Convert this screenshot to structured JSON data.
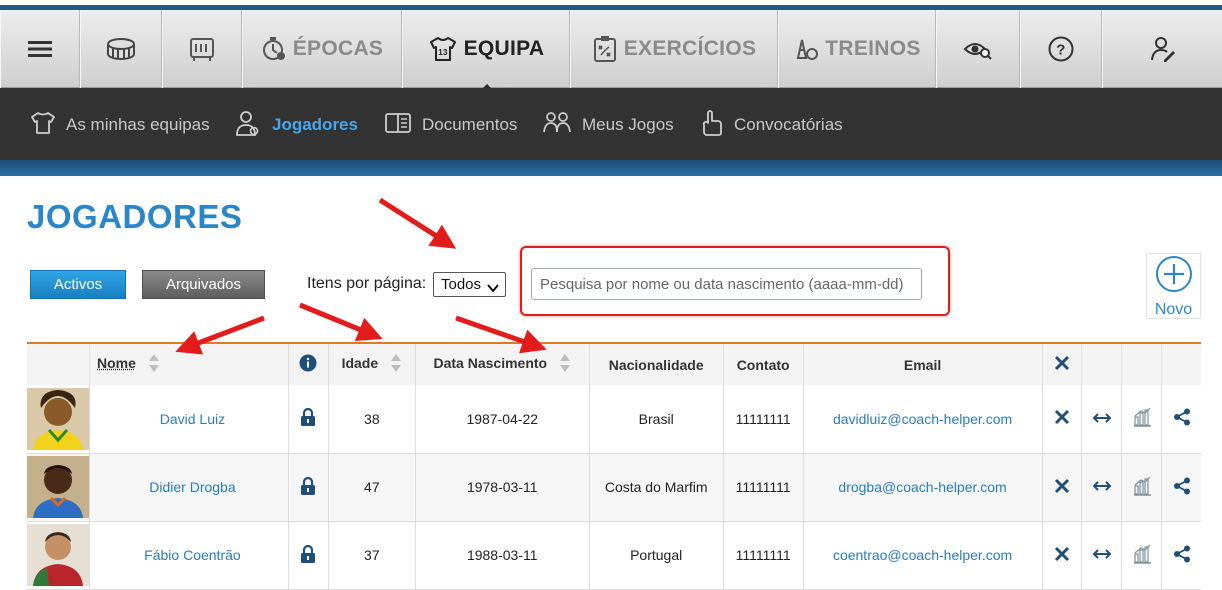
{
  "main_nav": {
    "items": [
      {
        "id": "menu",
        "icon": "hamburger-menu-icon",
        "label": ""
      },
      {
        "id": "stadium",
        "icon": "stadium-icon",
        "label": ""
      },
      {
        "id": "board",
        "icon": "scoreboard-icon",
        "label": ""
      },
      {
        "id": "epocas",
        "icon": "stopwatch-icon",
        "label": "ÉPOCAS"
      },
      {
        "id": "equipa",
        "icon": "jersey-icon",
        "label": "EQUIPA",
        "active": true
      },
      {
        "id": "exercicios",
        "icon": "tactics-board-icon",
        "label": "EXERCÍCIOS"
      },
      {
        "id": "treinos",
        "icon": "cones-ball-icon",
        "label": "TREINOS"
      },
      {
        "id": "scout",
        "icon": "eye-search-icon",
        "label": ""
      },
      {
        "id": "help",
        "icon": "help-circle-icon",
        "label": ""
      },
      {
        "id": "user",
        "icon": "user-edit-icon",
        "label": ""
      }
    ]
  },
  "sub_nav": {
    "items": [
      {
        "icon": "jersey-outline-icon",
        "label": "As minhas equipas"
      },
      {
        "icon": "player-icon",
        "label": "Jogadores",
        "active": true
      },
      {
        "icon": "book-icon",
        "label": "Documentos"
      },
      {
        "icon": "people-icon",
        "label": "Meus Jogos"
      },
      {
        "icon": "hand-point-icon",
        "label": "Convocatórias"
      }
    ]
  },
  "page": {
    "title": "JOGADORES",
    "filter_active": "Activos",
    "filter_archived": "Arquivados",
    "per_page_label": "Itens por página:",
    "per_page_value": "Todos",
    "search_placeholder": "Pesquisa por nome ou data nascimento (aaaa-mm-dd)",
    "new_label": "Novo"
  },
  "table": {
    "headers": {
      "nome": "Nome",
      "idade": "Idade",
      "data_nascimento": "Data Nascimento",
      "nacionalidade": "Nacionalidade",
      "contato": "Contato",
      "email": "Email"
    },
    "rows": [
      {
        "nome": "David Luiz",
        "idade": "38",
        "data_nascimento": "1987-04-22",
        "nacionalidade": "Brasil",
        "contato": "11111111",
        "email": "davidluiz@coach-helper.com"
      },
      {
        "nome": "Didier Drogba",
        "idade": "47",
        "data_nascimento": "1978-03-11",
        "nacionalidade": "Costa do Marfim",
        "contato": "11111111",
        "email": "drogba@coach-helper.com"
      },
      {
        "nome": "Fábio Coentrão",
        "idade": "37",
        "data_nascimento": "1988-03-11",
        "nacionalidade": "Portugal",
        "contato": "11111111",
        "email": "coentrao@coach-helper.com"
      }
    ]
  },
  "colors": {
    "accent_blue": "#2a86c8",
    "nav_dark": "#333333",
    "table_header_border": "#e07b20",
    "annotation_red": "#e31b1b"
  }
}
